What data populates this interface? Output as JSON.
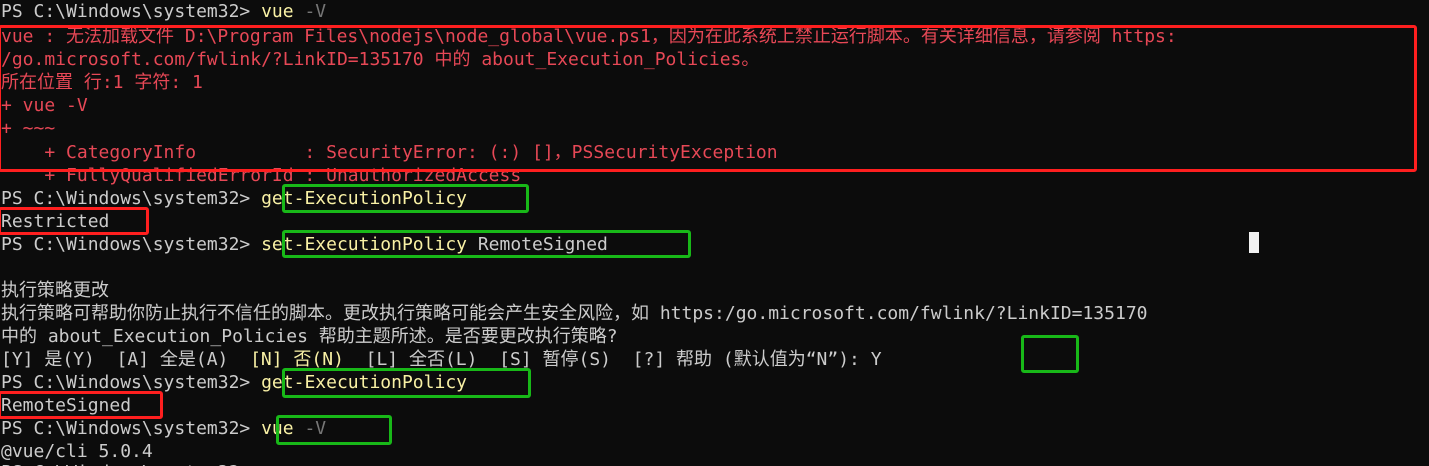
{
  "terminal": {
    "prompt": "PS C:\\Windows\\system32> ",
    "lines": [
      {
        "cmd": "vue",
        "arg": " -V"
      },
      {
        "text": "vue : 无法加载文件 D:\\Program Files\\nodejs\\node_global\\vue.ps1，因为在此系统上禁止运行脚本。有关详细信息，请参阅 https:"
      },
      {
        "text": "/go.microsoft.com/fwlink/?LinkID=135170 中的 about_Execution_Policies。"
      },
      {
        "text": "所在位置 行:1 字符: 1"
      },
      {
        "text": "+ vue -V"
      },
      {
        "text": "+ ~~~"
      },
      {
        "text": "    + CategoryInfo          : SecurityError: (:) []，PSSecurityException"
      },
      {
        "text": "    + FullyQualifiedErrorId : UnauthorizedAccess"
      },
      {
        "cmd": "get-ExecutionPolicy"
      },
      {
        "text": "Restricted"
      },
      {
        "cmd": "set-ExecutionPolicy",
        "arg": " RemoteSigned"
      },
      {
        "text": "执行策略更改"
      },
      {
        "text": "执行策略可帮助你防止执行不信任的脚本。更改执行策略可能会产生安全风险，如 https:/go.microsoft.com/fwlink/?LinkID=135170"
      },
      {
        "text": "中的 about_Execution_Policies 帮助主题所述。是否要更改执行策略?"
      },
      {
        "opt_a": "[Y] 是(Y)  [A] 全是(A)  ",
        "opt_default": "[N] 否(N)",
        "opt_b": "  [L] 全否(L)  [S] 暂停(S)  [?] 帮助 (默认值为“N”)",
        "answer": ": Y"
      },
      {
        "cmd": "get-ExecutionPolicy"
      },
      {
        "text": "RemoteSigned"
      },
      {
        "cmd": "vue",
        "arg": " -V"
      },
      {
        "text": "@vue/cli 5.0.4"
      }
    ]
  },
  "colors": {
    "background": "#0c0c0c",
    "text": "#cccccc",
    "command": "#f9f1a5",
    "parameter": "#767676",
    "error": "#e74856",
    "highlight_red": "#ff1f1f",
    "highlight_green": "#18b818"
  }
}
